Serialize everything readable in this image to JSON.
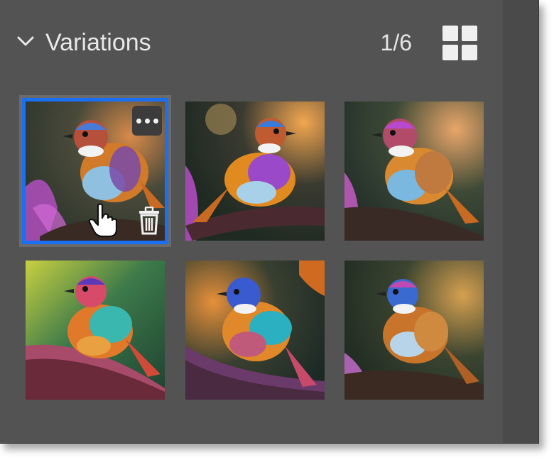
{
  "panel": {
    "title": "Variations",
    "counter": "1/6",
    "expanded": true,
    "selected_index": 0
  },
  "icons": {
    "collapse": "chevron-down-icon",
    "view_toggle": "grid-view-icon",
    "more": "more-options-icon",
    "delete": "trash-icon",
    "cursor": "hand-pointer-icon"
  },
  "colors": {
    "panel_bg": "#535353",
    "selection": "#1b6ff2",
    "text": "#e8e8e8"
  },
  "variations": [
    {
      "bg": "#3a4a3a",
      "accent": "#c85bd0",
      "glow": "#d88a4a"
    },
    {
      "bg": "#2d3a2e",
      "accent": "#b84fc8",
      "glow": "#f2a650"
    },
    {
      "bg": "#33402f",
      "accent": "#c75dc4",
      "glow": "#e9a66a"
    },
    {
      "bg": "#2f5a3a",
      "accent": "#d86070",
      "glow": "#c8d040"
    },
    {
      "bg": "#263832",
      "accent": "#c860a0",
      "glow": "#e6903a"
    },
    {
      "bg": "#2f3a2a",
      "accent": "#c26ac8",
      "glow": "#d6a050"
    }
  ]
}
